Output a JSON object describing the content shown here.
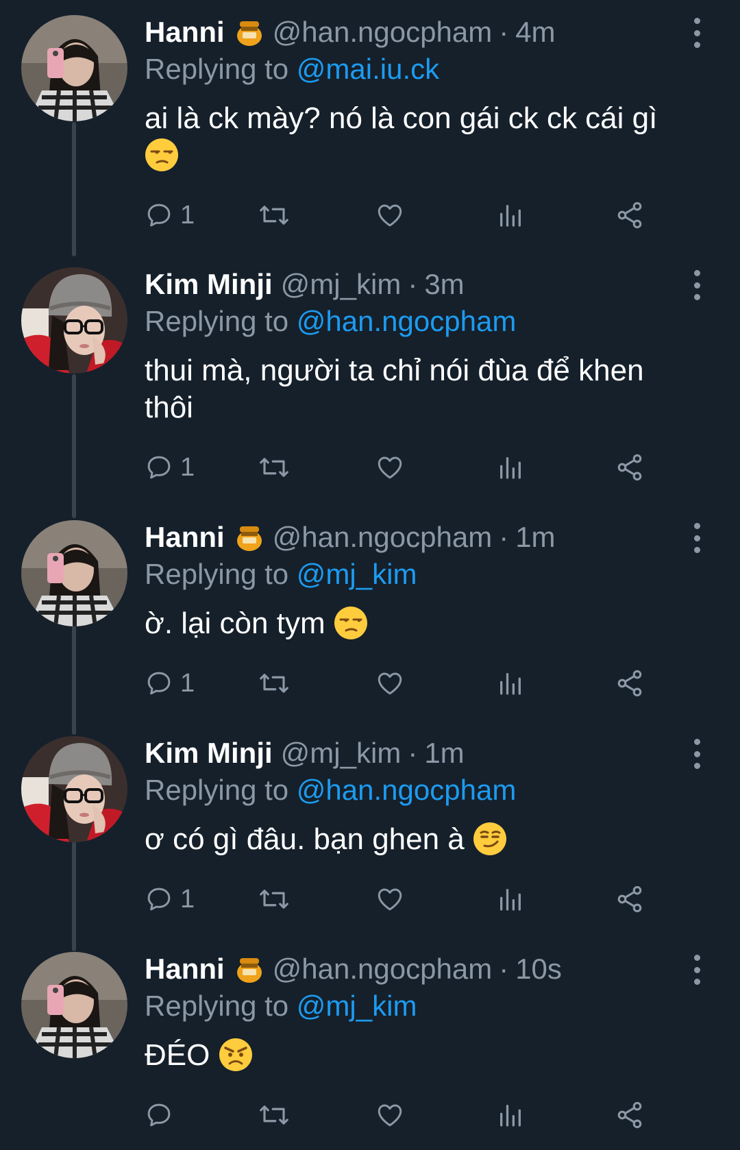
{
  "colors": {
    "background": "#15202b",
    "muted": "#8b98a5",
    "link": "#1d9bf0",
    "thread_line": "#38444d"
  },
  "tweets": [
    {
      "name": "Hanni",
      "badge_icon": "honey-pot-icon",
      "handle": "@han.ngocpham",
      "time": "4m",
      "replying_label": "Replying to",
      "replying_to": "@mai.iu.ck",
      "text": "ai là ck mày? nó là con gái ck ck cái gì",
      "emoji": "unamused-face-icon",
      "reply_count": "1"
    },
    {
      "name": "Kim Minji",
      "handle": "@mj_kim",
      "time": "3m",
      "replying_label": "Replying to",
      "replying_to": "@han.ngocpham",
      "text": "thui mà, người ta chỉ nói đùa để khen thôi",
      "reply_count": "1"
    },
    {
      "name": "Hanni",
      "badge_icon": "honey-pot-icon",
      "handle": "@han.ngocpham",
      "time": "1m",
      "replying_label": "Replying to",
      "replying_to": "@mj_kim",
      "text": "ờ. lại còn tym",
      "emoji": "unamused-face-icon",
      "reply_count": "1"
    },
    {
      "name": "Kim Minji",
      "handle": "@mj_kim",
      "time": "1m",
      "replying_label": "Replying to",
      "replying_to": "@han.ngocpham",
      "text": "ơ có gì đâu. bạn ghen à",
      "emoji": "smirking-face-icon",
      "reply_count": "1"
    },
    {
      "name": "Hanni",
      "badge_icon": "honey-pot-icon",
      "handle": "@han.ngocpham",
      "time": "10s",
      "replying_label": "Replying to",
      "replying_to": "@mj_kim",
      "text": "ĐÉO",
      "emoji": "angry-face-icon",
      "reply_count": ""
    }
  ],
  "dot_separator": "·"
}
